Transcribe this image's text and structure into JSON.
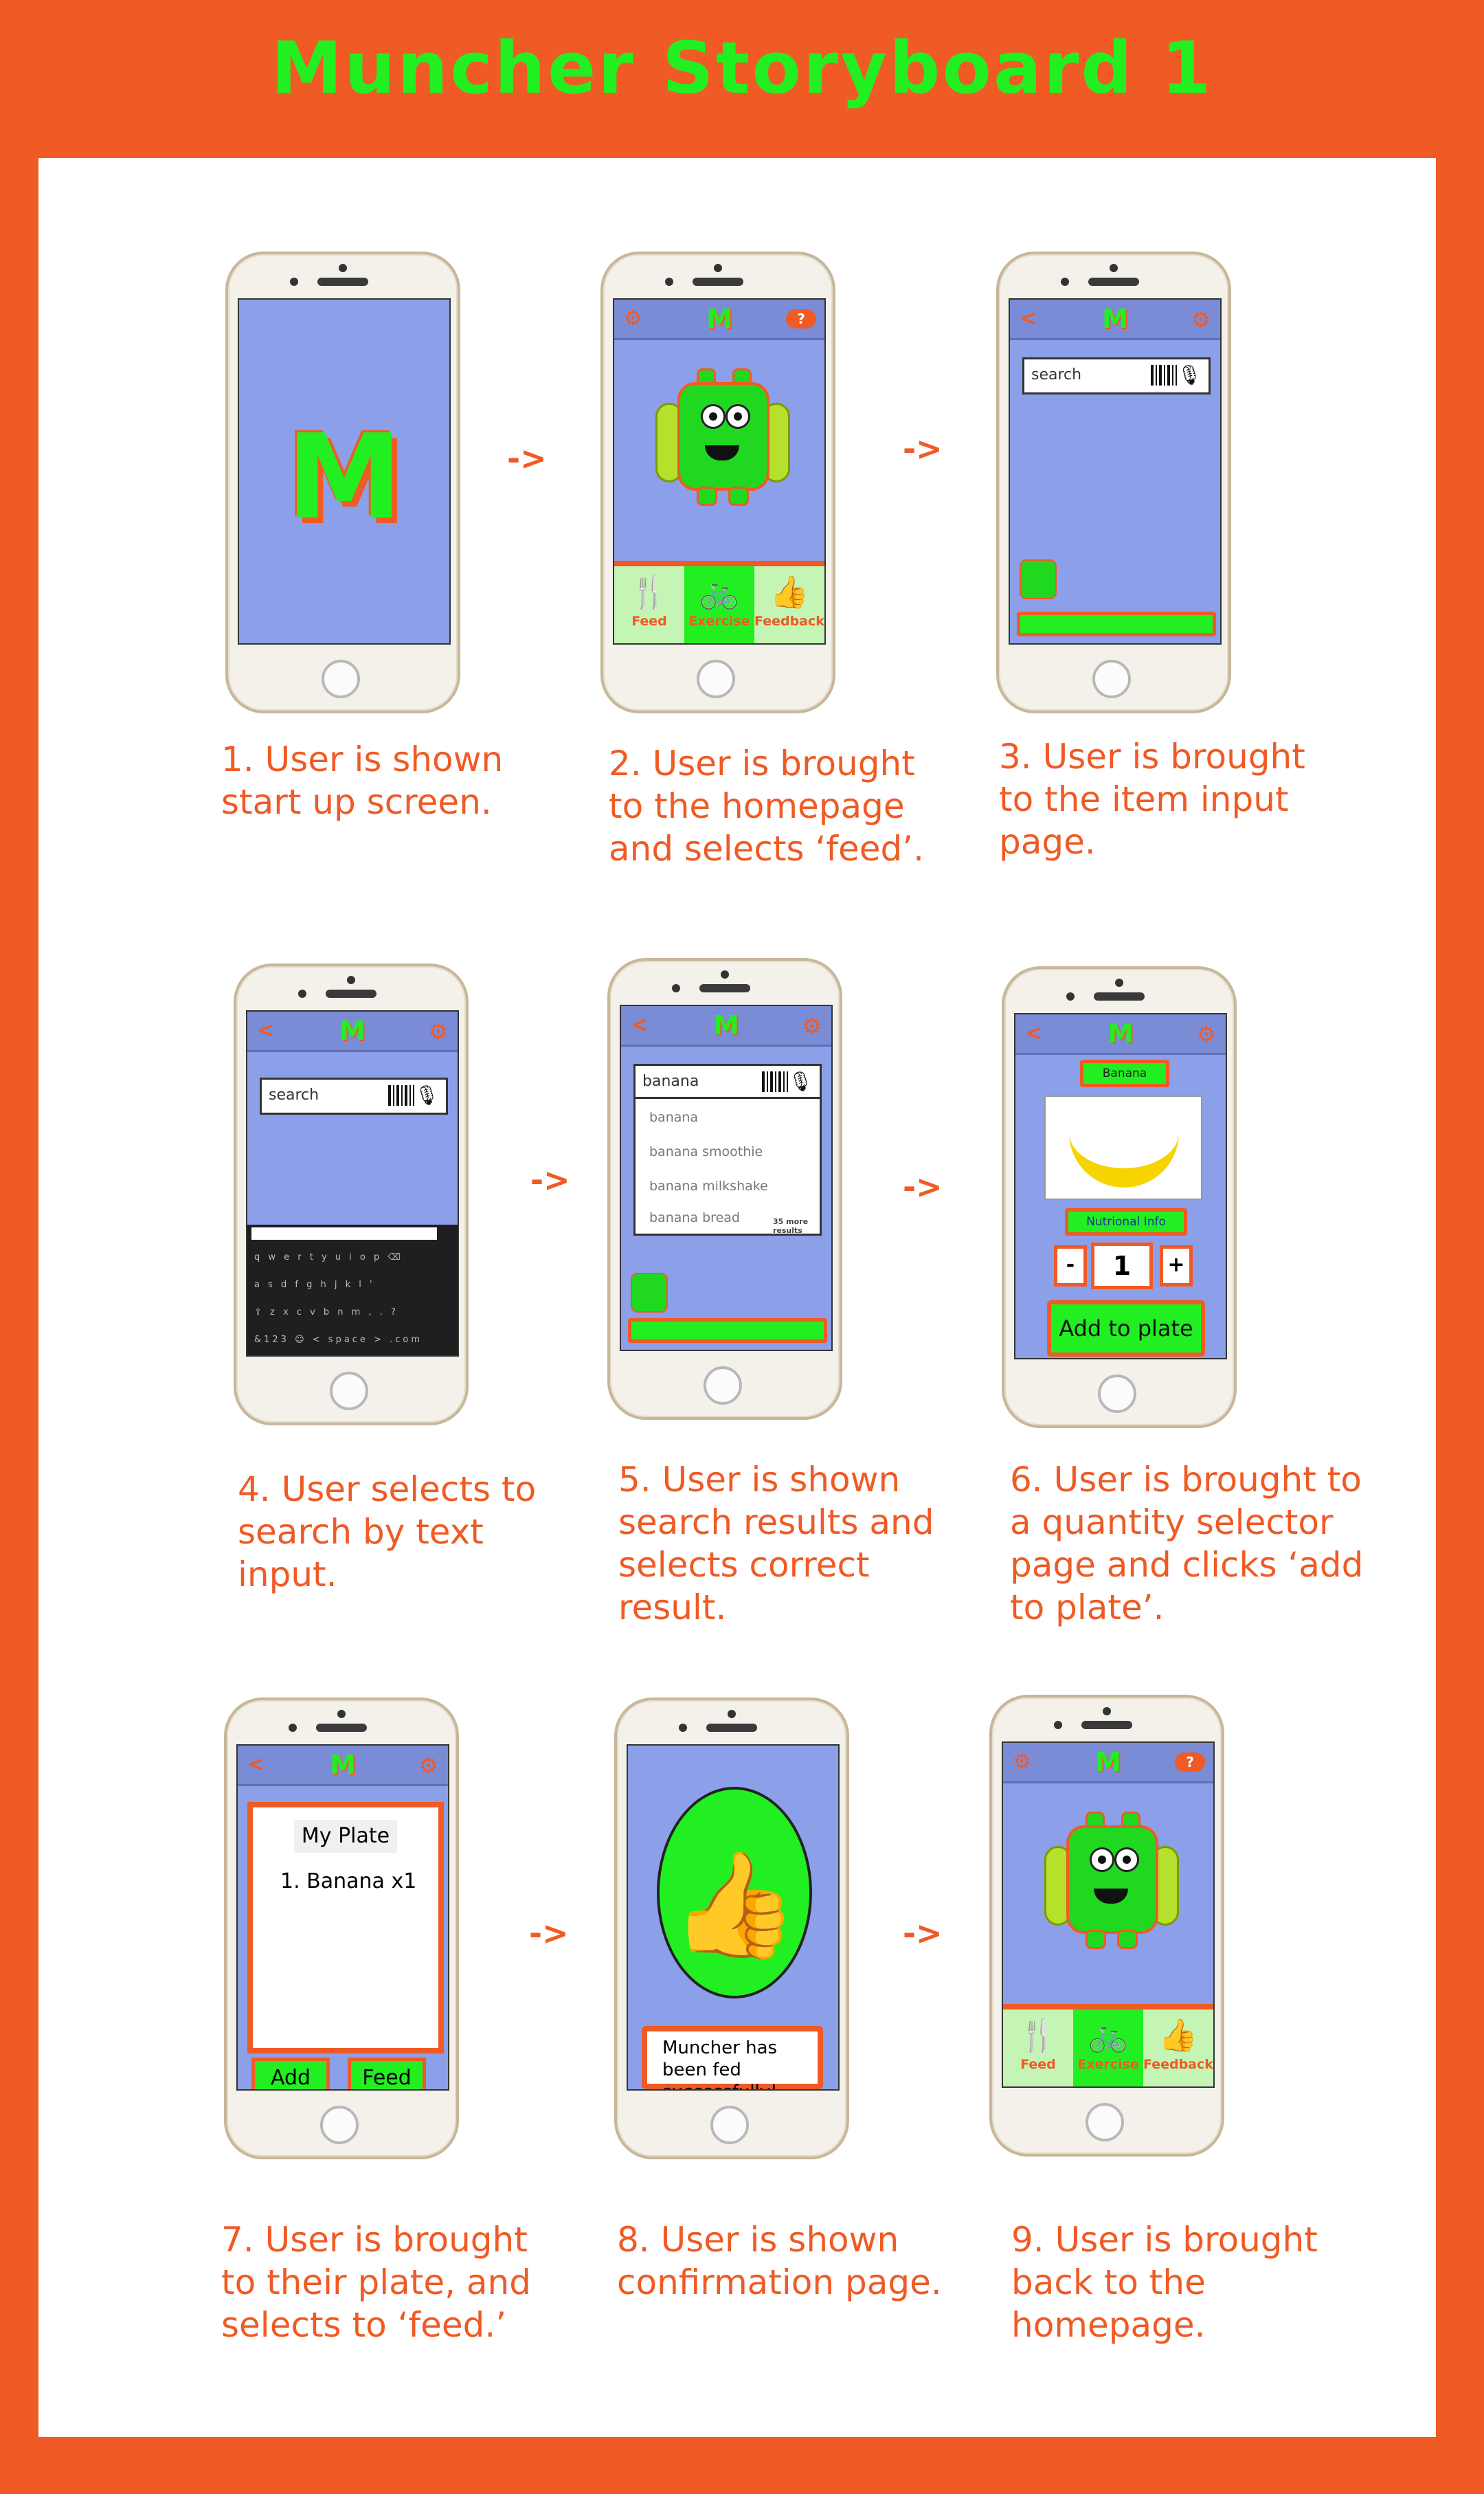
{
  "title": "Muncher Storyboard 1",
  "arrow": "->",
  "app": {
    "logo": "M",
    "back_icon": "<",
    "help_icon": "?",
    "accent_color": "#f05a24",
    "brand_green": "#22ef22",
    "screen_bg": "#8ba0e8"
  },
  "tabs": {
    "feed": "Feed",
    "exercise": "Exercise",
    "feedback": "Feedback"
  },
  "search": {
    "placeholder": "search",
    "query": "banana"
  },
  "keyboard": {
    "row1": "q w e r t y u i o p ⌫",
    "row2": "a s d f g h j k l '",
    "row3": "⇧ z x c v b n m , . ?",
    "row4": "&123 ☺ <  space  > .com"
  },
  "results": {
    "items": [
      "banana",
      "banana smoothie",
      "banana milkshake",
      "banana bread"
    ],
    "more": "35 more results"
  },
  "item": {
    "name": "Banana",
    "nutrition_label": "Nutrional Info",
    "minus": "-",
    "plus": "+",
    "quantity": "1",
    "add_to_plate": "Add to plate"
  },
  "plate": {
    "title": "My Plate",
    "item": "1. Banana x1",
    "add": "Add",
    "feed": "Feed"
  },
  "confirmation": {
    "message": "Muncher has been fed successfully!"
  },
  "captions": [
    "1. User is shown start up screen.",
    "2. User is brought to the homepage and selects ‘feed’.",
    "3. User is brought to the item input page.",
    "4. User selects to search by text input.",
    "5. User is shown search results and selects correct result.",
    "6. User is brought to a quantity selector page and clicks ‘add to plate’.",
    "7. User is brought to their plate, and selects to ‘feed.’",
    "8. User is shown confirmation page.",
    "9. User is brought back to the homepage."
  ]
}
